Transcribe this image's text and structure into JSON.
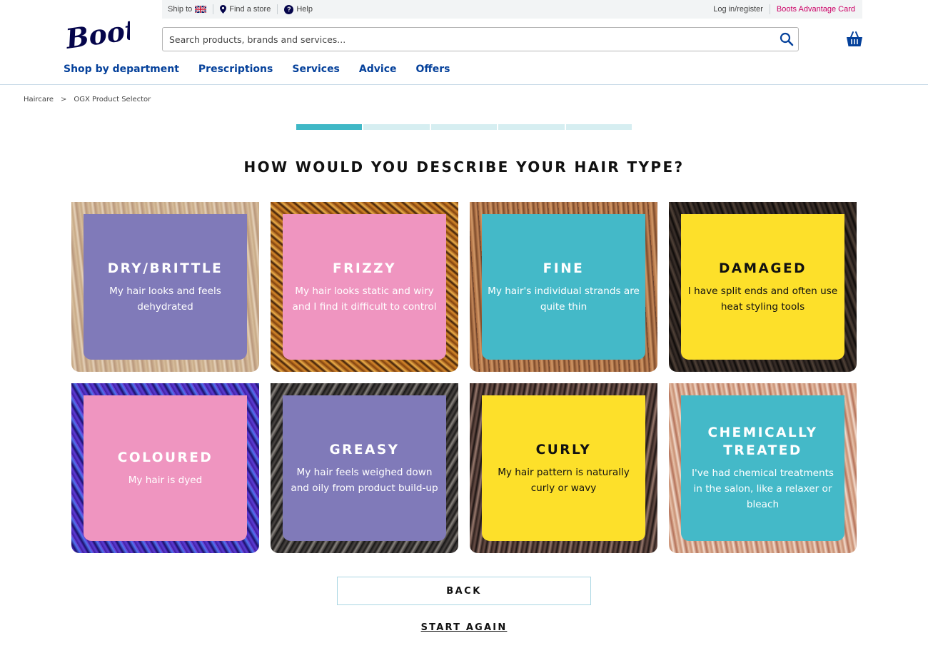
{
  "topbar": {
    "ship_to": "Ship to",
    "find_store": "Find a store",
    "help": "Help",
    "login": "Log in/register",
    "advantage_card": "Boots Advantage Card"
  },
  "logo": {
    "text": "Boots"
  },
  "search": {
    "placeholder": "Search products, brands and services..."
  },
  "nav": {
    "items": [
      "Shop by department",
      "Prescriptions",
      "Services",
      "Advice",
      "Offers"
    ]
  },
  "breadcrumb": {
    "items": [
      "Haircare",
      "OGX Product Selector"
    ],
    "separator": ">"
  },
  "progress": {
    "current_step": 1,
    "total_steps": 5
  },
  "question": "HOW WOULD YOU DESCRIBE YOUR HAIR TYPE?",
  "cards": [
    {
      "title": "DRY/BRITTLE",
      "desc": "My hair looks and feels dehydrated",
      "color": "#807ab9"
    },
    {
      "title": "FRIZZY",
      "desc": "My hair looks static and wiry and I find it difficult to control",
      "color": "#ef95c0"
    },
    {
      "title": "FINE",
      "desc": "My hair's individual strands are quite thin",
      "color": "#44b9c8"
    },
    {
      "title": "DAMAGED",
      "desc": "I have split ends and often use heat styling tools",
      "color": "#fde02a"
    },
    {
      "title": "COLOURED",
      "desc": "My hair is dyed",
      "color": "#ef95c0"
    },
    {
      "title": "GREASY",
      "desc": "My hair feels weighed down and oily from product build-up",
      "color": "#807ab9"
    },
    {
      "title": "CURLY",
      "desc": "My hair pattern is naturally curly or wavy",
      "color": "#fde02a"
    },
    {
      "title": "CHEMICALLY TREATED",
      "desc": "I've had chemical treatments in the salon, like a relaxer or bleach",
      "color": "#44b9c8"
    }
  ],
  "buttons": {
    "back": "BACK",
    "start_again": "START AGAIN"
  },
  "icons": {
    "flag": "uk-flag-icon",
    "find_store": "location-pin-icon",
    "help": "question-circle-icon",
    "search": "search-icon",
    "basket": "basket-icon"
  },
  "colors": {
    "brand_navy": "#05054b",
    "nav_blue": "#05419b",
    "accent_teal": "#3fb8c6",
    "advantage_pink": "#cc0066"
  }
}
